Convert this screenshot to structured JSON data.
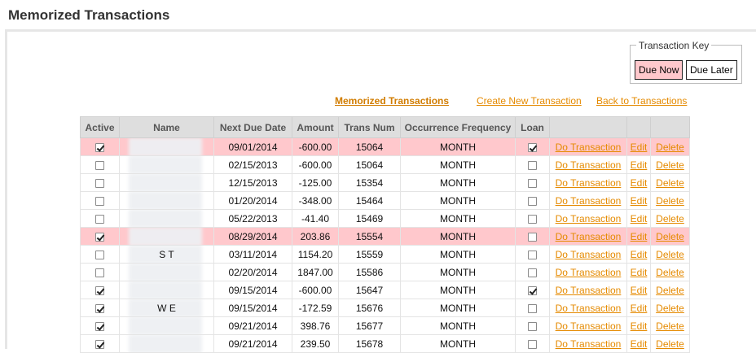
{
  "page_title": "Memorized Transactions",
  "key": {
    "legend": "Transaction Key",
    "due_now": "Due Now",
    "due_later": "Due Later"
  },
  "links": {
    "memorized": "Memorized Transactions",
    "create": "Create New Transaction",
    "back": "Back to Transactions"
  },
  "columns": [
    "Active",
    "Name",
    "Next Due Date",
    "Amount",
    "Trans Num",
    "Occurrence Frequency",
    "Loan",
    "",
    "",
    ""
  ],
  "rows": [
    {
      "active": true,
      "name": "",
      "date": "09/01/2014",
      "amount": "-600.00",
      "num": "15064",
      "freq": "MONTH",
      "loan": true,
      "due": true
    },
    {
      "active": false,
      "name": "",
      "date": "02/15/2013",
      "amount": "-600.00",
      "num": "15064",
      "freq": "MONTH",
      "loan": false,
      "due": false
    },
    {
      "active": false,
      "name": "",
      "date": "12/15/2013",
      "amount": "-125.00",
      "num": "15354",
      "freq": "MONTH",
      "loan": false,
      "due": false
    },
    {
      "active": false,
      "name": "",
      "date": "01/20/2014",
      "amount": "-348.00",
      "num": "15464",
      "freq": "MONTH",
      "loan": false,
      "due": false
    },
    {
      "active": false,
      "name": "",
      "date": "05/22/2013",
      "amount": "-41.40",
      "num": "15469",
      "freq": "MONTH",
      "loan": false,
      "due": false
    },
    {
      "active": true,
      "name": "",
      "date": "08/29/2014",
      "amount": "203.86",
      "num": "15554",
      "freq": "MONTH",
      "loan": false,
      "due": true
    },
    {
      "active": false,
      "name": "S                T",
      "date": "03/11/2014",
      "amount": "1154.20",
      "num": "15559",
      "freq": "MONTH",
      "loan": false,
      "due": false
    },
    {
      "active": false,
      "name": "",
      "date": "02/20/2014",
      "amount": "1847.00",
      "num": "15586",
      "freq": "MONTH",
      "loan": false,
      "due": false
    },
    {
      "active": true,
      "name": "",
      "date": "09/15/2014",
      "amount": "-600.00",
      "num": "15647",
      "freq": "MONTH",
      "loan": true,
      "due": false
    },
    {
      "active": true,
      "name": "W              E",
      "date": "09/15/2014",
      "amount": "-172.59",
      "num": "15676",
      "freq": "MONTH",
      "loan": false,
      "due": false
    },
    {
      "active": true,
      "name": "",
      "date": "09/21/2014",
      "amount": "398.76",
      "num": "15677",
      "freq": "MONTH",
      "loan": false,
      "due": false
    },
    {
      "active": true,
      "name": "",
      "date": "09/21/2014",
      "amount": "239.50",
      "num": "15678",
      "freq": "MONTH",
      "loan": false,
      "due": false
    }
  ],
  "actions": {
    "do": "Do Transaction",
    "edit": "Edit",
    "delete": "Delete"
  }
}
